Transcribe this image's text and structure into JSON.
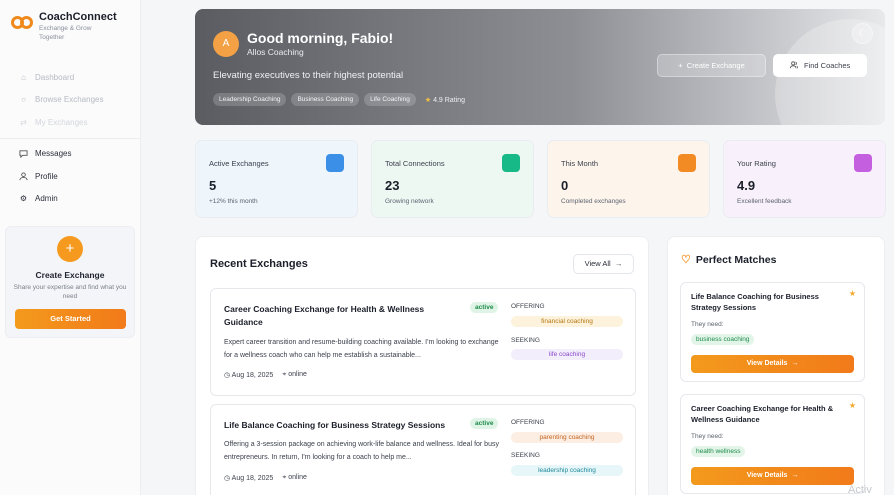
{
  "brand": {
    "name": "CoachConnect",
    "tagline": "Exchange & Grow Together"
  },
  "sidebar": {
    "items": [
      {
        "label": "Dashboard",
        "icon": "home-icon"
      },
      {
        "label": "Browse Exchanges",
        "icon": "search-icon"
      },
      {
        "label": "My Exchanges",
        "icon": "swap-icon"
      },
      {
        "label": "Messages",
        "icon": "chat-icon"
      },
      {
        "label": "Profile",
        "icon": "user-icon"
      },
      {
        "label": "Admin",
        "icon": "gear-icon"
      }
    ],
    "cta": {
      "title": "Create Exchange",
      "description": "Share your expertise and find what you need",
      "button": "Get Started"
    }
  },
  "hero": {
    "avatar_initial": "A",
    "greeting": "Good morning, Fabio!",
    "company": "Allos Coaching",
    "tagline": "Elevating executives to their highest potential",
    "tags": [
      "Leadership Coaching",
      "Business Coaching",
      "Life Coaching"
    ],
    "rating": "4.9 Rating",
    "create_button": "Create Exchange",
    "find_button": "Find Coaches"
  },
  "stats": [
    {
      "label": "Active Exchanges",
      "value": "5",
      "note": "+12% this month",
      "bg": "#eef5fb",
      "icon_color": "#3b8fe6"
    },
    {
      "label": "Total Connections",
      "value": "23",
      "note": "Growing network",
      "bg": "#eef8f3",
      "icon_color": "#17b987"
    },
    {
      "label": "This Month",
      "value": "0",
      "note": "Completed exchanges",
      "bg": "#fdf5ec",
      "icon_color": "#f38b25"
    },
    {
      "label": "Your Rating",
      "value": "4.9",
      "note": "Excellent feedback",
      "bg": "#f8f1fb",
      "icon_color": "#c45fe0"
    }
  ],
  "recent": {
    "title": "Recent Exchanges",
    "view_all": "View All",
    "offering_label": "OFFERING",
    "seeking_label": "SEEKING",
    "items": [
      {
        "title": "Career Coaching Exchange for Health & Wellness Guidance",
        "status": "active",
        "description": "Expert career transition and resume-building coaching available. I'm looking to exchange for a wellness coach who can help me establish a sustainable...",
        "date": "Aug 18, 2025",
        "location": "online",
        "offering": "financial coaching",
        "offering_bg": "#fdf3dc",
        "offering_color": "#b3760f",
        "seeking": "life coaching",
        "seeking_bg": "#f3eefb",
        "seeking_color": "#8a48c9"
      },
      {
        "title": "Life Balance Coaching for Business Strategy Sessions",
        "status": "active",
        "description": "Offering a 3-session package on achieving work-life balance and wellness. Ideal for busy entrepreneurs. In return, I'm looking for a coach to help me...",
        "date": "Aug 18, 2025",
        "location": "online",
        "offering": "parenting coaching",
        "offering_bg": "#fdeee3",
        "offering_color": "#c2621d",
        "seeking": "leadership coaching",
        "seeking_bg": "#e7f6f8",
        "seeking_color": "#1d8a9b"
      }
    ]
  },
  "matches": {
    "title": "Perfect Matches",
    "need_label": "They need:",
    "button": "View Details",
    "items": [
      {
        "title": "Life Balance Coaching for Business Strategy Sessions",
        "need": "business coaching"
      },
      {
        "title": "Career Coaching Exchange for Health & Wellness Guidance",
        "need": "health wellness"
      }
    ]
  },
  "watermark": "Activ"
}
